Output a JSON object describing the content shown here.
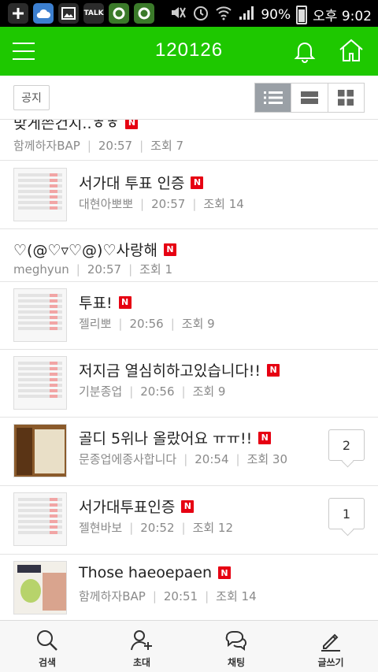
{
  "status_bar": {
    "left_icons": [
      "plus-icon",
      "cloud-icon",
      "image-icon",
      "talk-icon",
      "sync-icon",
      "sync-icon"
    ],
    "talk_label": "TALK",
    "battery": "90%",
    "time": "오후 9:02"
  },
  "app_bar": {
    "title": "120126"
  },
  "filter_bar": {
    "notice_label": "공지",
    "views": [
      "list-icon",
      "card-icon",
      "grid-icon"
    ]
  },
  "list": {
    "items": [
      {
        "title": "맞게쓴건지..ㅎㅎ",
        "new": "N",
        "author": "함께하자BAP",
        "time": "20:57",
        "views": "조회 7",
        "thumb": "none",
        "comments": ""
      },
      {
        "title": "서가대 투표 인증",
        "new": "N",
        "author": "대현아뽀뽀",
        "time": "20:57",
        "views": "조회 14",
        "thumb": "doc",
        "comments": ""
      },
      {
        "title": "♡(@♡▿♡@)♡사랑해",
        "new": "N",
        "author": "meghyun",
        "time": "20:57",
        "views": "조회 1",
        "thumb": "none",
        "comments": ""
      },
      {
        "title": "투표!",
        "new": "N",
        "author": "젤리뽀",
        "time": "20:56",
        "views": "조회 9",
        "thumb": "doc",
        "comments": ""
      },
      {
        "title": "저지금 열심히하고있습니다!!",
        "new": "N",
        "author": "기분종업",
        "time": "20:56",
        "views": "조회 9",
        "thumb": "doc",
        "comments": ""
      },
      {
        "title": "골디 5위나 올랐어요 ㅠㅠ!!",
        "new": "N",
        "author": "문종업에종사합니다",
        "time": "20:54",
        "views": "조회 30",
        "thumb": "photo",
        "comments": "2"
      },
      {
        "title": "서가대투표인증",
        "new": "N",
        "author": "젤현바보",
        "time": "20:52",
        "views": "조회 12",
        "thumb": "doc",
        "comments": "1"
      },
      {
        "title": "Those haeoepaen",
        "new": "N",
        "author": "함께하자BAP",
        "time": "20:51",
        "views": "조회 14",
        "thumb": "photo2",
        "comments": ""
      }
    ]
  },
  "bottom_bar": {
    "search": "검색",
    "invite": "초대",
    "chat": "채팅",
    "write": "글쓰기"
  },
  "colors": {
    "brand": "#1ec800",
    "new_badge": "#e60012"
  }
}
